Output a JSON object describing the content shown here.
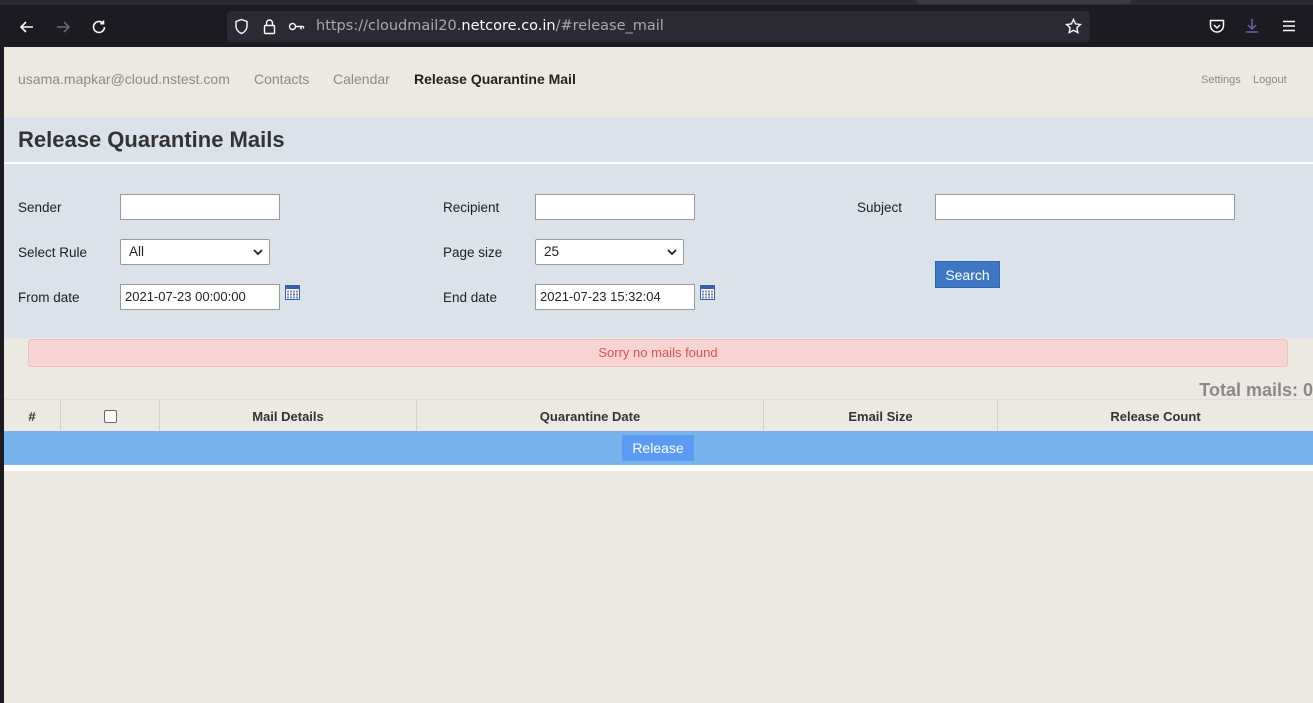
{
  "browser": {
    "url_prefix": "https://cloudmail20.",
    "url_host": "netcore.co.in",
    "url_suffix": "/#release_mail"
  },
  "topnav": {
    "user": "usama.mapkar@cloud.nstest.com",
    "contacts": "Contacts",
    "calendar": "Calendar",
    "release": "Release Quarantine Mail",
    "settings": "Settings",
    "logout": "Logout"
  },
  "page_title": "Release Quarantine Mails",
  "filters": {
    "sender_label": "Sender",
    "sender_value": "",
    "recipient_label": "Recipient",
    "recipient_value": "",
    "subject_label": "Subject",
    "subject_value": "",
    "rule_label": "Select Rule",
    "rule_value": "All",
    "pagesize_label": "Page size",
    "pagesize_value": "25",
    "from_label": "From date",
    "from_value": "2021-07-23 00:00:00",
    "end_label": "End date",
    "end_value": "2021-07-23 15:32:04",
    "search_button": "Search"
  },
  "alert": "Sorry no mails found",
  "total_mails": "Total mails: 0",
  "table": {
    "columns": [
      "#",
      "",
      "Mail Details",
      "Quarantine Date",
      "Email Size",
      "Release Count"
    ]
  },
  "release_button": "Release"
}
